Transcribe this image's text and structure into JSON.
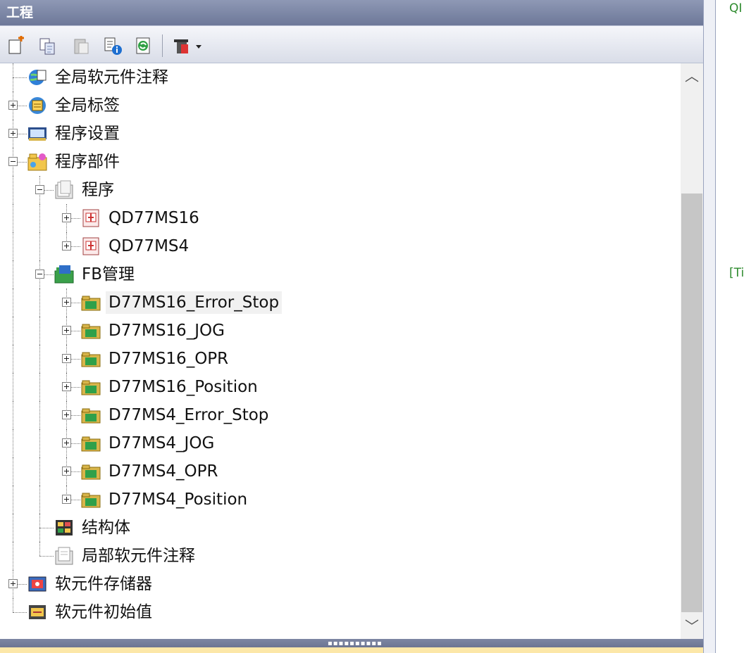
{
  "window": {
    "title": "工程"
  },
  "toolbar": {
    "buttons": [
      {
        "icon": "new-item-icon"
      },
      {
        "icon": "copy-icon"
      },
      {
        "icon": "paste-icon"
      },
      {
        "icon": "properties-info-icon"
      },
      {
        "icon": "refresh-icon"
      },
      {
        "icon": "view-options-dropdown-icon"
      }
    ]
  },
  "tree": [
    {
      "label": "全局软元件注释",
      "level": 1,
      "icon": "global-device-comment-icon",
      "expander": "none",
      "connector": "branch"
    },
    {
      "label": "全局标签",
      "level": 1,
      "icon": "global-label-icon",
      "expander": "plus",
      "connector": "branch"
    },
    {
      "label": "程序设置",
      "level": 1,
      "icon": "program-settings-icon",
      "expander": "plus",
      "connector": "branch"
    },
    {
      "label": "程序部件",
      "level": 1,
      "icon": "program-parts-icon",
      "expander": "minus",
      "connector": "branch"
    },
    {
      "label": "程序",
      "level": 2,
      "icon": "program-folder-icon",
      "expander": "minus",
      "connector": "branch"
    },
    {
      "label": "QD77MS16",
      "level": 3,
      "icon": "program-file-icon",
      "expander": "plus",
      "connector": "branch"
    },
    {
      "label": "QD77MS4",
      "level": 3,
      "icon": "program-file-icon",
      "expander": "plus",
      "connector": "last"
    },
    {
      "label": "FB管理",
      "level": 2,
      "icon": "fb-management-icon",
      "expander": "minus",
      "connector": "branch"
    },
    {
      "label": "D77MS16_Error_Stop",
      "level": 3,
      "icon": "fb-folder-icon",
      "expander": "plus",
      "connector": "branch",
      "selected": true
    },
    {
      "label": "D77MS16_JOG",
      "level": 3,
      "icon": "fb-folder-icon",
      "expander": "plus",
      "connector": "branch"
    },
    {
      "label": "D77MS16_OPR",
      "level": 3,
      "icon": "fb-folder-icon",
      "expander": "plus",
      "connector": "branch"
    },
    {
      "label": "D77MS16_Position",
      "level": 3,
      "icon": "fb-folder-icon",
      "expander": "plus",
      "connector": "branch"
    },
    {
      "label": "D77MS4_Error_Stop",
      "level": 3,
      "icon": "fb-folder-icon",
      "expander": "plus",
      "connector": "branch"
    },
    {
      "label": "D77MS4_JOG",
      "level": 3,
      "icon": "fb-folder-icon",
      "expander": "plus",
      "connector": "branch"
    },
    {
      "label": "D77MS4_OPR",
      "level": 3,
      "icon": "fb-folder-icon",
      "expander": "plus",
      "connector": "branch"
    },
    {
      "label": "D77MS4_Position",
      "level": 3,
      "icon": "fb-folder-icon",
      "expander": "plus",
      "connector": "last"
    },
    {
      "label": "结构体",
      "level": 2,
      "icon": "structure-icon",
      "expander": "none",
      "connector": "branch"
    },
    {
      "label": "局部软元件注释",
      "level": 2,
      "icon": "local-device-comment-icon",
      "expander": "none",
      "connector": "last"
    },
    {
      "label": "软元件存储器",
      "level": 1,
      "icon": "device-memory-icon",
      "expander": "plus",
      "connector": "branch"
    },
    {
      "label": "软元件初始值",
      "level": 1,
      "icon": "device-initial-value-icon",
      "expander": "none",
      "connector": "last"
    }
  ],
  "right_pane": {
    "texts": [
      "QI",
      "[Ti"
    ]
  },
  "colors": {
    "title_bar": "#7b85a4",
    "selection": "#f1f1f1",
    "fb_folder": "#d8b54a",
    "right_text": "#2e8b2e"
  }
}
